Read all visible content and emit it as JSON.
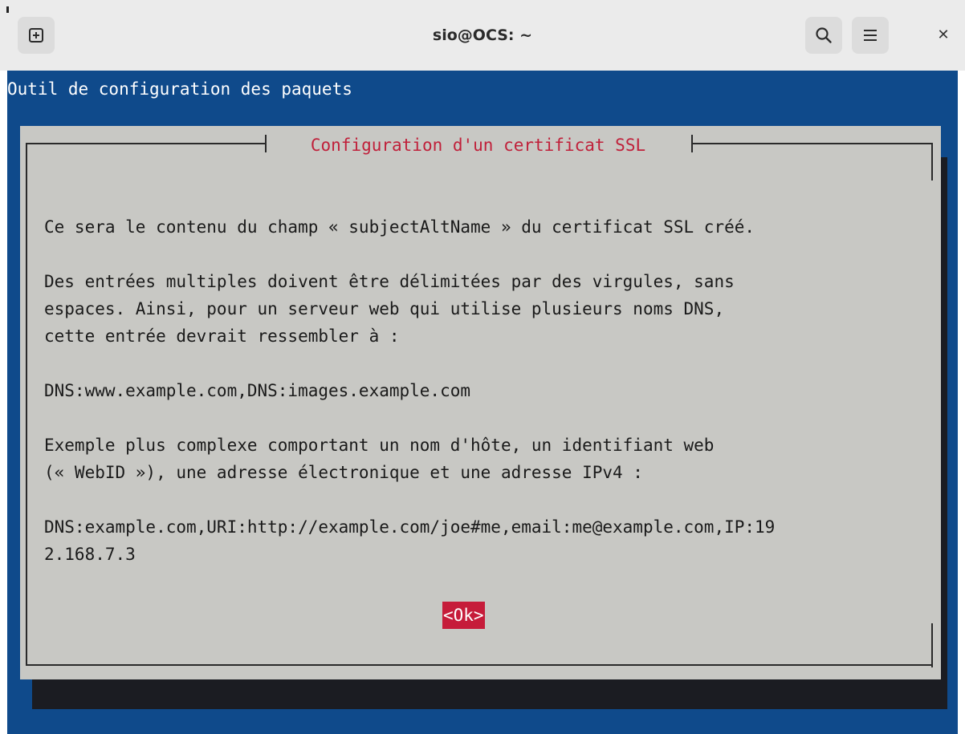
{
  "window": {
    "title": "sio@OCS: ~",
    "close_glyph": "✕"
  },
  "icons": {
    "new_tab": "new-tab-icon",
    "search": "search-icon",
    "menu": "hamburger-menu-icon",
    "close": "close-icon"
  },
  "colors": {
    "terminal_background": "#0f4a8b",
    "dialog_background": "#c8c8c4",
    "dialog_title": "#c0203a",
    "ok_button": "#c61c3a"
  },
  "terminal": {
    "backtitle": "Outil de configuration des paquets"
  },
  "dialog": {
    "title": " Configuration d'un certificat SSL ",
    "lines": [
      "Ce sera le contenu du champ « subjectAltName » du certificat SSL créé.",
      "Des entrées multiples doivent être délimitées par des virgules, sans",
      "espaces. Ainsi, pour un serveur web qui utilise plusieurs noms DNS,",
      "cette entrée devrait ressembler à :",
      "DNS:www.example.com,DNS:images.example.com",
      "Exemple plus complexe comportant un nom d'hôte, un identifiant web",
      "(« WebID »), une adresse électronique et une adresse IPv4 :",
      "DNS:example.com,URI:http://example.com/joe#me,email:me@example.com,IP:19",
      "2.168.7.3"
    ],
    "ok_label": "<Ok>"
  }
}
